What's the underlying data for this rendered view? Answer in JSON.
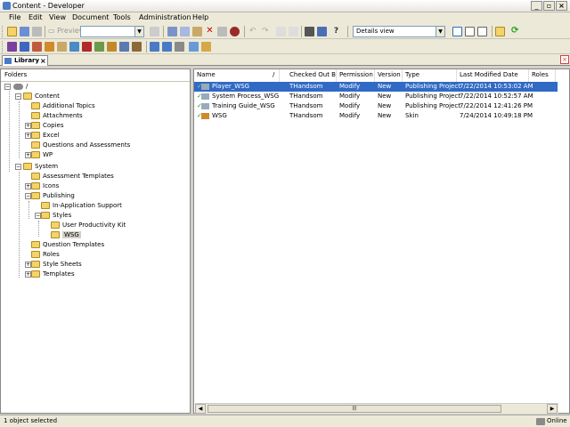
{
  "window": {
    "title": "Content - Developer"
  },
  "menu": {
    "items": [
      "File",
      "Edit",
      "View",
      "Document",
      "Tools",
      "Administration",
      "Help"
    ]
  },
  "toolbar": {
    "preview_label": "Preview",
    "view_select": "Details view"
  },
  "library_tab": {
    "label": "Library",
    "close": "×"
  },
  "tree": {
    "header": "Folders",
    "root": "/",
    "items": [
      {
        "label": "Content"
      },
      {
        "label": "Additional Topics"
      },
      {
        "label": "Attachments"
      },
      {
        "label": "Copies"
      },
      {
        "label": "Excel"
      },
      {
        "label": "Questions and Assessments"
      },
      {
        "label": "WP"
      },
      {
        "label": "System"
      },
      {
        "label": "Assessment Templates"
      },
      {
        "label": "Icons"
      },
      {
        "label": "Publishing"
      },
      {
        "label": "In-Application Support"
      },
      {
        "label": "Styles"
      },
      {
        "label": "User Productivity Kit"
      },
      {
        "label": "WSG"
      },
      {
        "label": "Question Templates"
      },
      {
        "label": "Roles"
      },
      {
        "label": "Style Sheets"
      },
      {
        "label": "Templates"
      }
    ]
  },
  "table": {
    "columns": [
      "Name",
      "/",
      "Checked Out By",
      "Permission",
      "Version",
      "Type",
      "Last Modified Date",
      "Roles"
    ],
    "rows": [
      {
        "name": "Player_WSG",
        "checked_out_by": "THandsom",
        "permission": "Modify",
        "version": "New",
        "type": "Publishing Project",
        "modified": "7/22/2014 10:53:02 AM",
        "roles": ""
      },
      {
        "name": "System Process_WSG",
        "checked_out_by": "THandsom",
        "permission": "Modify",
        "version": "New",
        "type": "Publishing Project",
        "modified": "7/22/2014 10:52:57 AM",
        "roles": ""
      },
      {
        "name": "Training Guide_WSG",
        "checked_out_by": "THandsom",
        "permission": "Modify",
        "version": "New",
        "type": "Publishing Project",
        "modified": "7/22/2014 12:41:26 PM",
        "roles": ""
      },
      {
        "name": "WSG",
        "checked_out_by": "THandsom",
        "permission": "Modify",
        "version": "New",
        "type": "Skin",
        "modified": "7/24/2014 10:49:18 PM",
        "roles": ""
      }
    ]
  },
  "status": {
    "left": "1 object selected",
    "right": "Online"
  },
  "colors": {
    "selection": "#316ac5",
    "folder": "#f3d36b",
    "check": "#1a9e1a"
  }
}
